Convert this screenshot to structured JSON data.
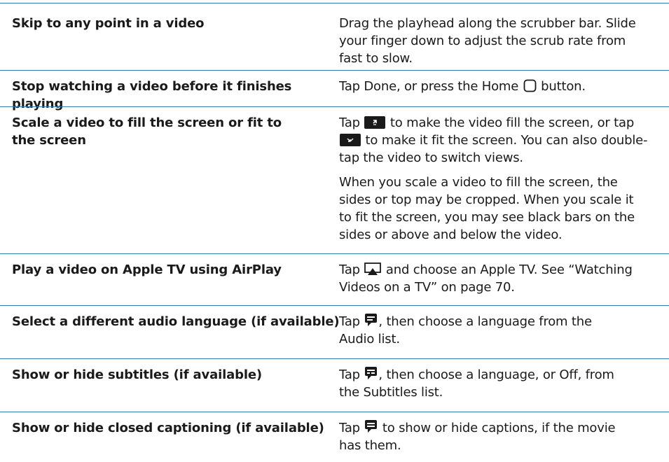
{
  "rows": [
    {
      "task": "Skip to any point in a video",
      "action": [
        "Drag the playhead along the scrubber bar. Slide your finger down to adjust the scrub rate from fast to slow."
      ]
    },
    {
      "task": "Stop watching a video before it finishes playing",
      "action_pre": "Tap Done, or press the Home ",
      "icon": "home-button-icon",
      "action_post": " button."
    },
    {
      "task": "Scale a video to fill the screen or fit to the screen",
      "p1_a": "Tap ",
      "icon1": "fill-screen-icon",
      "p1_b": " to make the video fill the screen, or tap ",
      "icon2": "fit-screen-icon",
      "p1_c": " to make it fit the screen. You can also double-tap the video to switch views.",
      "p2": "When you scale a video to fill the screen, the sides or top may be cropped. When you scale it to fit the screen, you may see black bars on the sides or above and below the video."
    },
    {
      "task": "Play a video on Apple TV using AirPlay",
      "action_pre": "Tap ",
      "icon": "airplay-icon",
      "action_post": " and choose an Apple TV. See “Watching Videos on a TV” on page 70."
    },
    {
      "task": "Select a different audio language (if available)",
      "action_pre": "Tap ",
      "icon": "audio-language-icon",
      "action_post": ", then choose a language from the Audio list."
    },
    {
      "task": "Show or hide subtitles (if available)",
      "action_pre": "Tap ",
      "icon": "subtitles-icon",
      "action_post": ", then choose a language, or Off, from the Subtitles list."
    },
    {
      "task": "Show or hide closed captioning (if available)",
      "action_pre": "Tap ",
      "icon": "captions-icon",
      "action_post": " to show or hide captions, if the movie has them."
    }
  ]
}
